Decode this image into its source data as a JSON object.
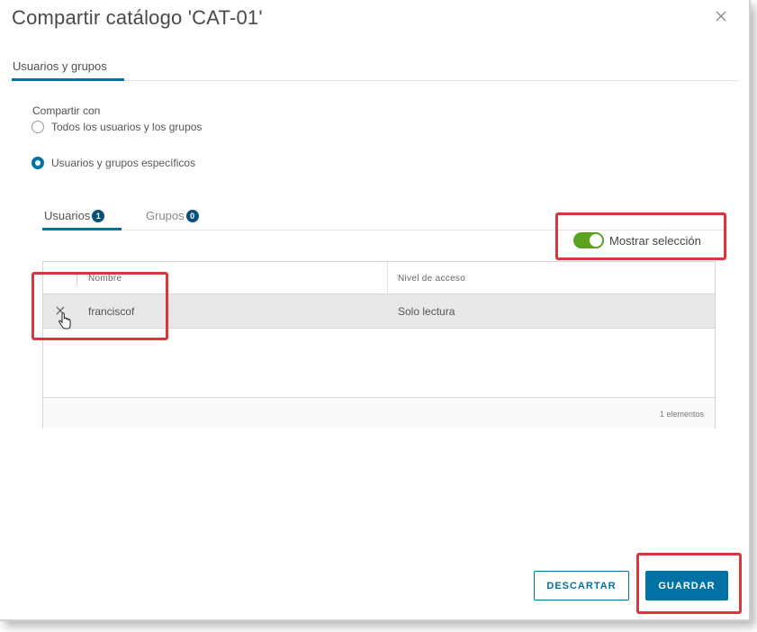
{
  "dialog": {
    "title": "Compartir catálogo 'CAT-01'",
    "close_icon": "close-icon"
  },
  "tabs": {
    "top": [
      {
        "label": "Usuarios y grupos",
        "active": true
      }
    ]
  },
  "share": {
    "label": "Compartir con",
    "options": [
      {
        "label": "Todos los usuarios y los grupos",
        "selected": false
      },
      {
        "label": "Usuarios y grupos específicos",
        "selected": true
      }
    ]
  },
  "sub_tabs": [
    {
      "label": "Usuarios",
      "count": "1",
      "active": true
    },
    {
      "label": "Grupos",
      "count": "0",
      "active": false
    }
  ],
  "toggle": {
    "label": "Mostrar selección",
    "on": true
  },
  "grid": {
    "columns": [
      "Nombre",
      "Nivel de acceso"
    ],
    "rows": [
      {
        "name": "franciscof",
        "access": "Solo lectura",
        "remove_icon": "remove-icon"
      }
    ],
    "footer": "1 elementos"
  },
  "buttons": {
    "discard": "DESCARTAR",
    "save": "GUARDAR"
  },
  "colors": {
    "accent": "#0072a3",
    "toggle_on": "#5aa220",
    "highlight": "#d9363e",
    "badge": "#0a4f7a"
  }
}
